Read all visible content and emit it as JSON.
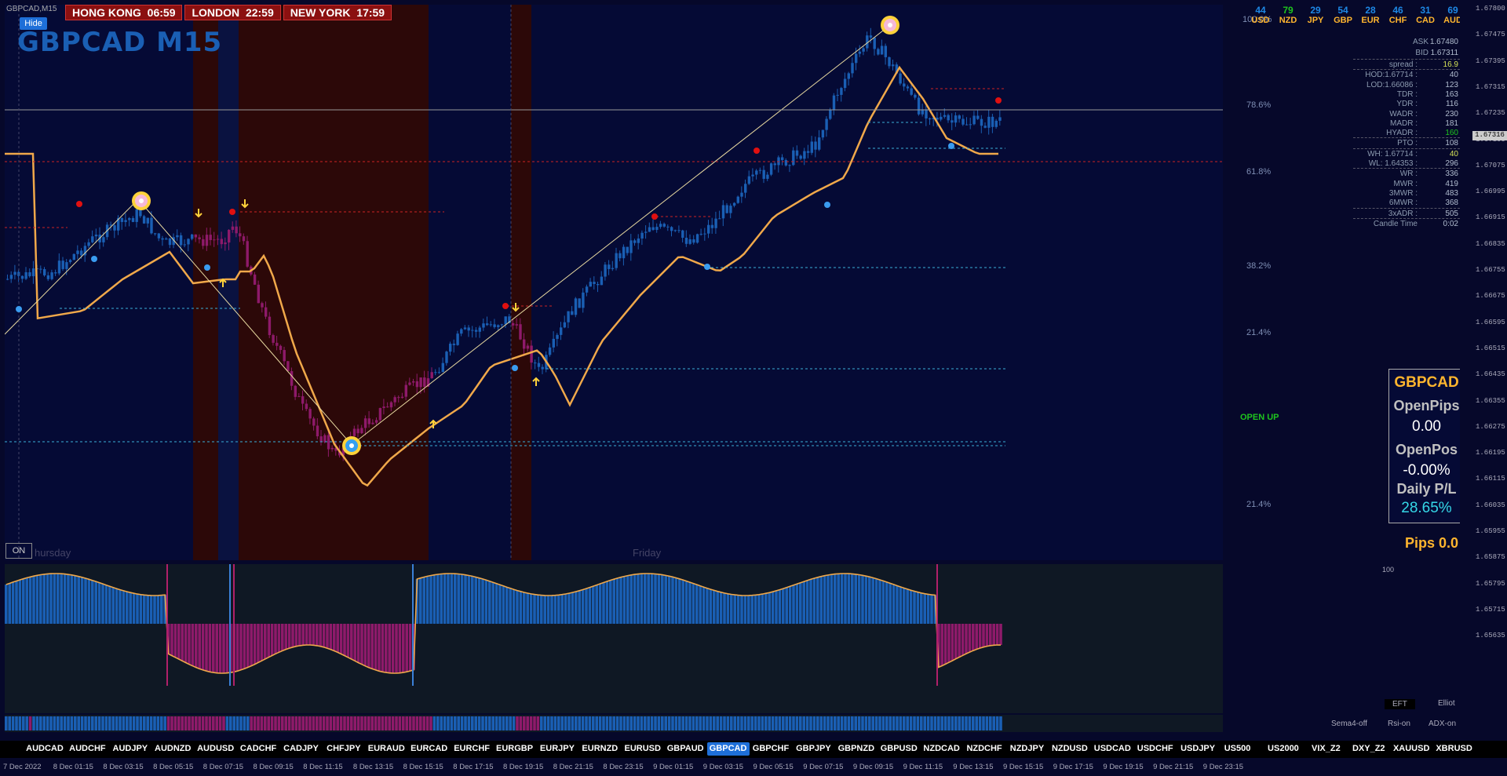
{
  "chart": {
    "caption": "GBPCAD,M15",
    "title": "GBPCAD M15",
    "hide_label": "Hide",
    "on_label": "ON",
    "day_labels": [
      "hursday",
      "Friday"
    ]
  },
  "clocks": [
    {
      "label": "HONG KONG",
      "time": "06:59"
    },
    {
      "label": "LONDON",
      "time": "22:59"
    },
    {
      "label": "NEW YORK",
      "time": "17:59"
    }
  ],
  "currency_strength": [
    {
      "value": "44",
      "currency": "USD",
      "color": "#1e88e5"
    },
    {
      "value": "79",
      "currency": "NZD",
      "color": "#1ec41e"
    },
    {
      "value": "29",
      "currency": "JPY",
      "color": "#1e88e5"
    },
    {
      "value": "54",
      "currency": "GBP",
      "color": "#1e88e5"
    },
    {
      "value": "28",
      "currency": "EUR",
      "color": "#1e88e5"
    },
    {
      "value": "46",
      "currency": "CHF",
      "color": "#1e88e5"
    },
    {
      "value": "31",
      "currency": "CAD",
      "color": "#1e88e5"
    },
    {
      "value": "69",
      "currency": "AUD",
      "color": "#1e88e5"
    }
  ],
  "stats": [
    {
      "label": "ASK",
      "value": "1.67480"
    },
    {
      "label": "BID",
      "value": "1.67311"
    },
    {
      "label": "spread :",
      "value": "16.9",
      "color": "#d4e157"
    },
    {
      "label": "HOD:1.67714 :",
      "value": "40"
    },
    {
      "label": "LOD:1.66086 :",
      "value": "123"
    },
    {
      "label": "TDR :",
      "value": "163"
    },
    {
      "label": "YDR :",
      "value": "116"
    },
    {
      "label": "WADR :",
      "value": "230"
    },
    {
      "label": "MADR :",
      "value": "181"
    },
    {
      "label": "HYADR :",
      "value": "160",
      "color": "#1ec41e"
    },
    {
      "label": "PTO :",
      "value": "108"
    },
    {
      "label": "WH: 1.67714 :",
      "value": "40",
      "color": "#d4e157"
    },
    {
      "label": "WL: 1.64353 :",
      "value": "296"
    },
    {
      "label": "WR :",
      "value": "336"
    },
    {
      "label": "MWR :",
      "value": "419"
    },
    {
      "label": "3MWR :",
      "value": "483"
    },
    {
      "label": "6MWR :",
      "value": "368"
    },
    {
      "label": "3xADR :",
      "value": "505"
    },
    {
      "label": "Candle Time",
      "value": "0:02"
    }
  ],
  "pl_panel": {
    "symbol": "GBPCAD",
    "open_pips_label": "OpenPips",
    "open_pips_value": "0.00",
    "open_pos_label": "OpenPos",
    "open_pos_value": "-0.00%",
    "daily_pl_label": "Daily P/L",
    "daily_pl_value": "28.65%"
  },
  "pips_label": "Pips 0.0",
  "open_up_label": "OPEN UP",
  "fib_levels": [
    "100.0%",
    "78.6%",
    "61.8%",
    "38.2%",
    "21.4%",
    "21.4%"
  ],
  "price_ticks": [
    "1.67800",
    "1.67475",
    "1.67395",
    "1.67315",
    "1.67235",
    "1.67155",
    "1.67075",
    "1.66995",
    "1.66915",
    "1.66835",
    "1.66755",
    "1.66675",
    "1.66595",
    "1.66515",
    "1.66435",
    "1.66355",
    "1.66275",
    "1.66195",
    "1.66115",
    "1.66035",
    "1.65955",
    "1.65875",
    "1.65795",
    "1.65715",
    "1.65635"
  ],
  "current_price": "1.67316",
  "osc_scale": "100",
  "indicator_buttons": [
    "EFT",
    "Elliot",
    "Sema4-off",
    "Rsi-on",
    "ADX-on"
  ],
  "symbols": [
    "AUDCAD",
    "AUDCHF",
    "AUDJPY",
    "AUDNZD",
    "AUDUSD",
    "CADCHF",
    "CADJPY",
    "CHFJPY",
    "EURAUD",
    "EURCAD",
    "EURCHF",
    "EURGBP",
    "EURJPY",
    "EURNZD",
    "EURUSD",
    "GBPAUD",
    "GBPCAD",
    "GBPCHF",
    "GBPJPY",
    "GBPNZD",
    "GBPUSD",
    "NZDCAD",
    "NZDCHF",
    "NZDJPY",
    "NZDUSD",
    "USDCAD",
    "USDCHF",
    "USDJPY",
    "US500",
    "US2000",
    "VIX_Z2",
    "DXY_Z2",
    "XAUUSD",
    "XBRUSD"
  ],
  "active_symbol": "GBPCAD",
  "time_ticks": [
    "7 Dec 2022",
    "8 Dec 01:15",
    "8 Dec 03:15",
    "8 Dec 05:15",
    "8 Dec 07:15",
    "8 Dec 09:15",
    "8 Dec 11:15",
    "8 Dec 13:15",
    "8 Dec 15:15",
    "8 Dec 17:15",
    "8 Dec 19:15",
    "8 Dec 21:15",
    "8 Dec 23:15",
    "9 Dec 01:15",
    "9 Dec 03:15",
    "9 Dec 05:15",
    "9 Dec 07:15",
    "9 Dec 09:15",
    "9 Dec 11:15",
    "9 Dec 13:15",
    "9 Dec 15:15",
    "9 Dec 17:15",
    "9 Dec 19:15",
    "9 Dec 21:15",
    "9 Dec 23:15"
  ],
  "colors": {
    "bull": "#1a5fb4",
    "bear": "#8e1a6a",
    "ma": "#f0a84a",
    "accent": "#ffb52e"
  }
}
